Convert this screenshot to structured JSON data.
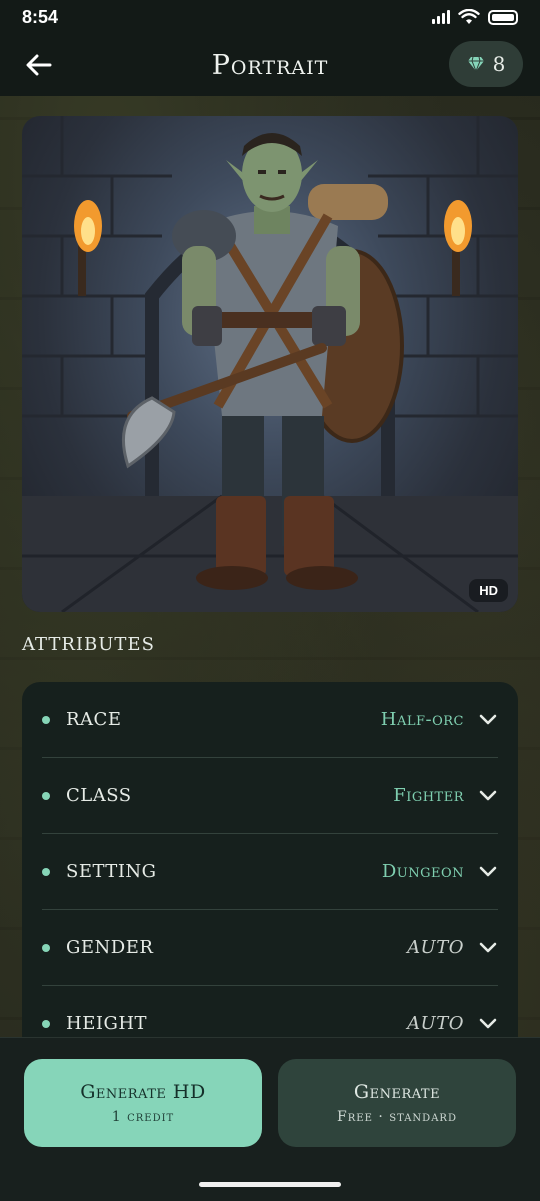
{
  "status_bar": {
    "time": "8:54"
  },
  "header": {
    "title": "Portrait",
    "credits": "8"
  },
  "portrait": {
    "badge": "HD"
  },
  "attributes": {
    "title": "ATTRIBUTES",
    "rows": [
      {
        "name": "RACE",
        "value": "Half-orc"
      },
      {
        "name": "CLASS",
        "value": "Fighter"
      },
      {
        "name": "SETTING",
        "value": "Dungeon"
      },
      {
        "name": "GENDER",
        "value": "AUTO"
      },
      {
        "name": "HEIGHT",
        "value": "AUTO"
      }
    ]
  },
  "actions": {
    "generate_hd": {
      "title": "Generate HD",
      "subtitle": "1 credit"
    },
    "generate": {
      "title": "Generate",
      "subtitle": "Free · standard"
    }
  },
  "colors": {
    "accent": "#86d5b9",
    "value_text": "#7fcfb0",
    "panel": "#16201d"
  },
  "icons": [
    "back-arrow-icon",
    "gem-icon",
    "chevron-down-icon",
    "wifi-icon",
    "battery-icon",
    "signal-icon"
  ]
}
